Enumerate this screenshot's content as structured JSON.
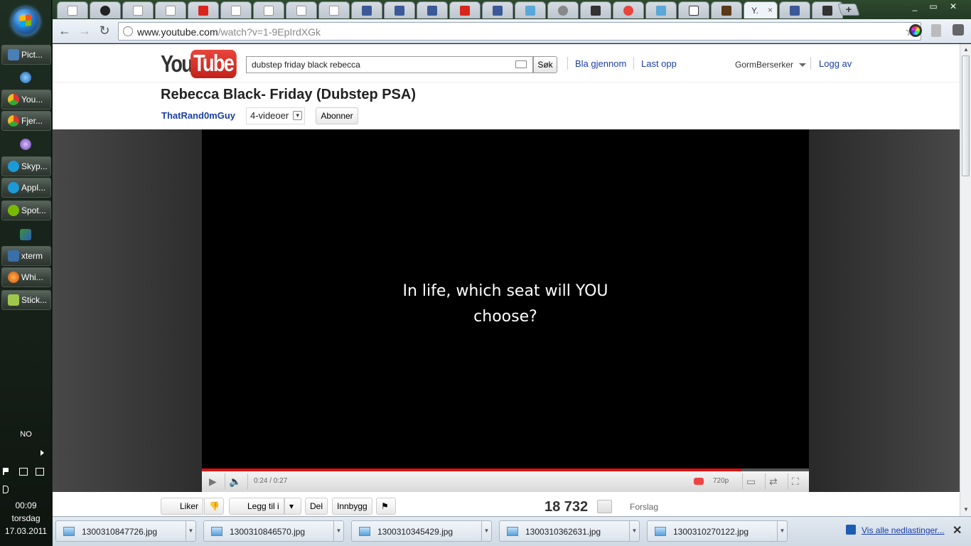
{
  "taskbar": {
    "items": [
      {
        "label": "Pict...",
        "icon": "image-viewer-icon",
        "color": "#4a7fb5"
      },
      {
        "label": "You...",
        "icon": "chrome-icon",
        "color": "#e0a020"
      },
      {
        "label": "Fjer...",
        "icon": "chrome-icon",
        "color": "#e0a020"
      },
      {
        "label": "Skyp...",
        "icon": "skype-icon",
        "color": "#1c9ad6"
      },
      {
        "label": "Appl...",
        "icon": "skype-icon",
        "color": "#1c9ad6"
      },
      {
        "label": "Spot...",
        "icon": "spotify-icon",
        "color": "#7ab800"
      },
      {
        "label": "xterm",
        "icon": "xterm-icon",
        "color": "#3a6fa8"
      },
      {
        "label": "Whi...",
        "icon": "firefox-icon",
        "color": "#e66b1a"
      },
      {
        "label": "Stick...",
        "icon": "sticky-notes-icon",
        "color": "#9fc84a"
      }
    ],
    "language": "NO",
    "clock": {
      "time": "00:09",
      "day": "torsdag",
      "date": "17.03.2011"
    }
  },
  "browser": {
    "active_tab_label": "Y.",
    "active_tab_close": "×",
    "new_tab_label": "+",
    "url_host": "www.youtube.com",
    "url_path": "/watch?v=1-9EpIrdXGk"
  },
  "youtube": {
    "logo_you": "You",
    "logo_tube": "Tube",
    "search_value": "dubstep friday black rebecca",
    "search_button": "Søk",
    "nav_browse": "Bla gjennom",
    "nav_upload": "Last opp",
    "username": "GormBerserker",
    "logout": "Logg av",
    "video_title": "Rebecca Black- Friday (Dubstep PSA)",
    "channel": "ThatRand0mGuy",
    "video_count": "4-videoer",
    "subscribe": "Abonner",
    "caption_line1": "In life, which seat will YOU",
    "caption_line2": "choose?",
    "time": "0:24 / 0:27",
    "progress_fraction": 0.889,
    "quality": "720p",
    "like": "Liker",
    "add_to": "Legg til i",
    "share": "Del",
    "embed": "Innbygg",
    "views": "18 732",
    "suggestions": "Forslag"
  },
  "downloads": {
    "files": [
      "1300310847726.jpg",
      "1300310846570.jpg",
      "1300310345429.jpg",
      "1300310362631.jpg",
      "1300310270122.jpg"
    ],
    "show_all": "Vis alle nedlastinger..."
  }
}
